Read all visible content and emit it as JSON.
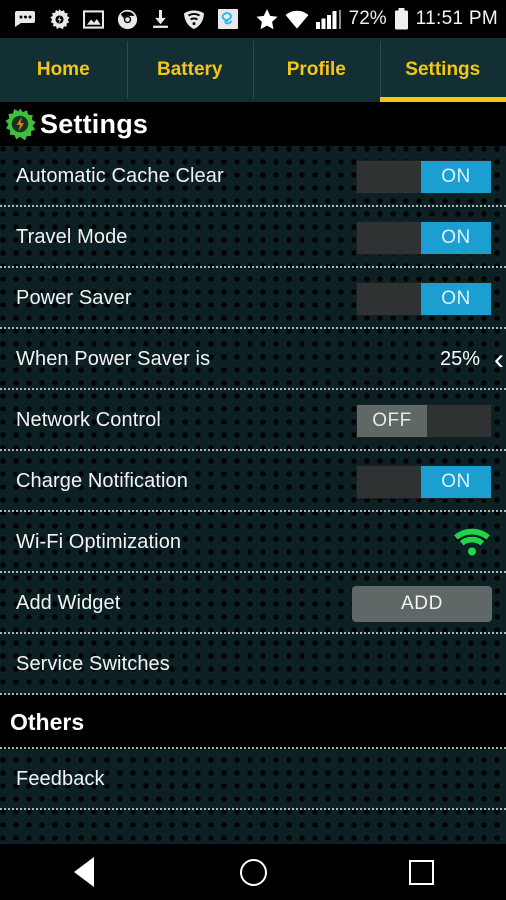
{
  "statusbar": {
    "icons": [
      "messages-icon",
      "settings-gear-icon",
      "photo-icon",
      "chrome-icon",
      "download-icon",
      "vpn-shield-icon",
      "app-badge-icon"
    ],
    "star_icon": "star-icon",
    "wifi_icon": "wifi-signal-icon",
    "cellular_icon": "cellular-signal-icon",
    "battery_percent": "72%",
    "battery_icon": "battery-full-icon",
    "time": "11:51 PM"
  },
  "tabs": [
    {
      "label": "Home",
      "active": false
    },
    {
      "label": "Battery",
      "active": false
    },
    {
      "label": "Profile",
      "active": false
    },
    {
      "label": "Settings",
      "active": true
    }
  ],
  "header": {
    "icon": "power-gear-icon",
    "title": "Settings"
  },
  "rows": [
    {
      "label": "Automatic Cache Clear",
      "control": "toggle",
      "state": "ON"
    },
    {
      "label": "Travel Mode",
      "control": "toggle",
      "state": "ON"
    },
    {
      "label": "Power Saver",
      "control": "toggle",
      "state": "ON"
    },
    {
      "label": "When Power Saver is",
      "control": "value",
      "value": "25%",
      "chevron": "‹"
    },
    {
      "label": "Network Control",
      "control": "toggle",
      "state": "OFF"
    },
    {
      "label": "Charge Notification",
      "control": "toggle",
      "state": "ON"
    },
    {
      "label": "Wi-Fi Optimization",
      "control": "wifi"
    },
    {
      "label": "Add Widget",
      "control": "button",
      "button_label": "ADD"
    },
    {
      "label": "Service Switches",
      "control": "none"
    }
  ],
  "section": {
    "title": "Others"
  },
  "others_rows": [
    {
      "label": "Feedback"
    },
    {
      "label": ""
    }
  ],
  "navbar": {
    "back": "back-icon",
    "home": "home-icon",
    "recent": "recent-apps-icon"
  },
  "colors": {
    "tab_bg": "#123033",
    "tab_accent": "#f5c518",
    "list_bg": "#0d2124",
    "toggle_on": "#1b9ed0",
    "toggle_off": "#5f6767",
    "wifi_green": "#1fd64a"
  }
}
